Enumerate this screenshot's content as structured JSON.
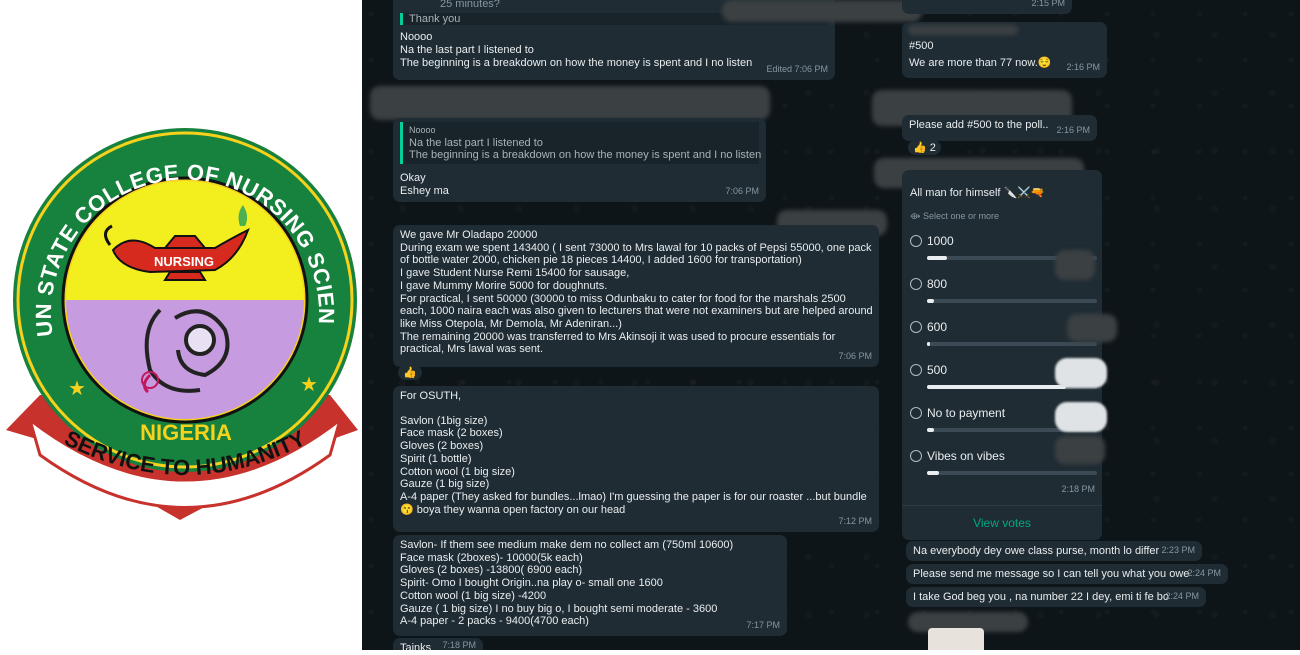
{
  "logo": {
    "arc_text": "OGUN STATE COLLEGE OF NURSING SCIENCES",
    "lamp_label": "NURSING",
    "country": "NIGERIA",
    "motto": "SERVICE TO HUMANITY"
  },
  "chat": {
    "top_snippet": "25 minutes?",
    "msg1": {
      "quote": "Thank you",
      "lines": [
        "Noooo",
        "Na the last part I listened to",
        "The beginning is a breakdown on how the money is spent and I no listen"
      ],
      "time": "Edited 7:06 PM"
    },
    "msg2": {
      "quote_lines": [
        "Noooo",
        "Na the last part I listened to",
        "The beginning is a breakdown on how the money is spent and I no listen"
      ],
      "lines": [
        "Okay",
        "Eshey ma"
      ],
      "time": "7:06 PM"
    },
    "msg3": {
      "lines": [
        "We gave Mr Oladapo 20000",
        "During exam we spent 143400 ( I sent 73000 to Mrs lawal for 10 packs of Pepsi 55000, one pack",
        "of bottle water 2000, chicken pie 18 pieces 14400, I added 1600 for transportation)",
        "I gave Student Nurse Remi 15400 for sausage,",
        "I gave Mummy Morire 5000 for doughnuts.",
        "For practical, I sent 50000 (30000 to miss Odunbaku to cater for food for the marshals 2500",
        "each, 1000 naira each was also given to lecturers that were not examiners but are helped around",
        "like Miss Otepola, Mr Demola, Mr Adeniran...)",
        "The remaining 20000 was transferred to Mrs Akinsoji  it was used to procure essentials for",
        "practical, Mrs lawal was sent."
      ],
      "time": "7:06 PM",
      "reaction": "👍"
    },
    "msg4": {
      "lines": [
        "For OSUTH,",
        "",
        "Savlon (1big size)",
        "Face mask (2 boxes)",
        "Gloves (2 boxes)",
        "Spirit (1 bottle)",
        "Cotton wool (1 big size)",
        "Gauze (1 big size)",
        "A-4 paper (They asked for bundles...lmao) I'm guessing the paper is for our roaster ...but bundle",
        "😙 boya they wanna open factory on our head"
      ],
      "time": "7:12 PM"
    },
    "msg5": {
      "lines": [
        "Savlon- If them see medium  make dem no collect am (750ml 10600)",
        "Face mask (2boxes)- 10000(5k each)",
        "Gloves (2 boxes) -13800( 6900 each)",
        "Spirit- Omo I bought Origin..na play o- small one 1600",
        "Cotton wool (1 big size) -4200",
        "Gauze ( 1 big size) I no buy big o, I bought semi moderate - 3600",
        "A-4 paper - 2 packs - 9400(4700 each)"
      ],
      "time": "7:17 PM"
    },
    "msg6": {
      "text": "Tainks",
      "time": "7:18 PM"
    },
    "right_top_time": "2:15 PM",
    "msg7": {
      "lines": [
        "#500",
        "We are more than 77 now.😌"
      ],
      "time": "2:16 PM"
    },
    "msg8": {
      "text": "Please add #500 to the poll..",
      "time": "2:16 PM",
      "reaction": "👍 2"
    },
    "poll": {
      "title": "All man for himself 🔪⚔️🔫",
      "subtitle": "Select one or more",
      "options": [
        {
          "label": "1000",
          "fraction": 0.12
        },
        {
          "label": "800",
          "fraction": 0.04
        },
        {
          "label": "600",
          "fraction": 0.02
        },
        {
          "label": "500",
          "fraction": 0.82
        },
        {
          "label": "No to payment",
          "fraction": 0.04
        },
        {
          "label": "Vibes on vibes",
          "fraction": 0.07
        }
      ],
      "time": "2:18 PM",
      "view_votes": "View votes"
    },
    "msg9": {
      "text": "Na everybody dey owe class purse, month lo differ",
      "time": "2:23 PM"
    },
    "msg10": {
      "text": "Please send me message so I can tell you what you owe",
      "time": "2:24 PM"
    },
    "msg11": {
      "text": "I take God beg you , na number 22 I dey, emi ti fe bo",
      "time": "2:24 PM"
    },
    "colors": {
      "accent": "#06cf9c",
      "bubble": "#1f2c33",
      "background": "#0e1519",
      "view_votes": "#00a884"
    }
  }
}
